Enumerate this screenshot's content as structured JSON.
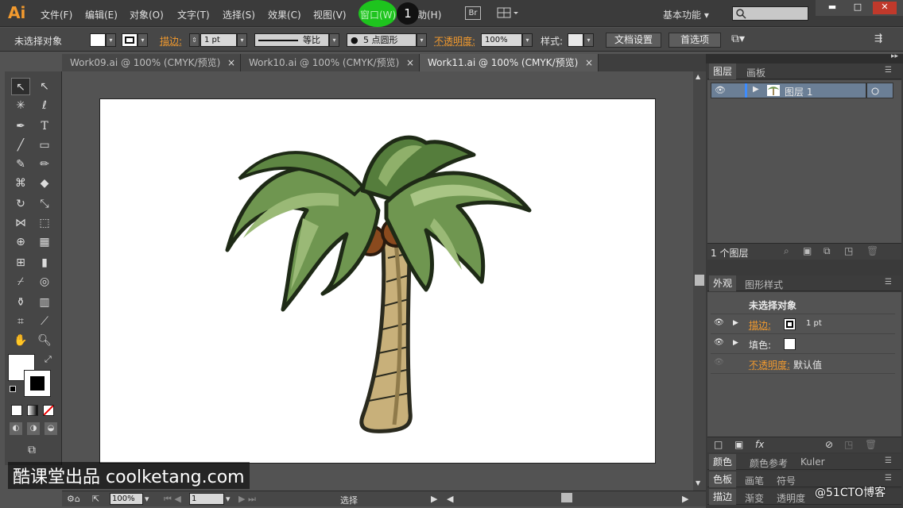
{
  "app": {
    "logo": "Ai"
  },
  "menus": [
    "文件(F)",
    "编辑(E)",
    "对象(O)",
    "文字(T)",
    "选择(S)",
    "效果(C)",
    "视图(V)",
    "窗口(W)",
    "帮助(H)"
  ],
  "toolbar_right": {
    "bridge": "Br",
    "workspace": "基本功能 ▾"
  },
  "window_controls": {
    "minimize": "▬",
    "restore": "□",
    "close": "✕"
  },
  "step_badge": "1",
  "control_bar": {
    "selection_status": "未选择对象",
    "stroke_label": "描边:",
    "stroke_value": "1 pt",
    "stroke_profile": "等比",
    "brush": "5 点圆形",
    "opacity_label": "不透明度:",
    "opacity_value": "100%",
    "style_label": "样式:",
    "doc_setup_button": "文档设置",
    "preferences_button": "首选项"
  },
  "doc_tabs": [
    {
      "label": "Work09.ai @ 100% (CMYK/预览)",
      "active": false
    },
    {
      "label": "Work10.ai @ 100% (CMYK/预览)",
      "active": false
    },
    {
      "label": "Work11.ai @ 100% (CMYK/预览)",
      "active": true
    }
  ],
  "status_bar": {
    "zoom": "100%",
    "page": "1",
    "status": "选择"
  },
  "watermarks": {
    "left": "酷课堂出品 coolketang.com",
    "right": "@51CTO博客"
  },
  "layers_panel": {
    "tabs": [
      "图层",
      "画板"
    ],
    "layer_name": "图层 1",
    "footer_count": "1 个图层"
  },
  "appearance_panel": {
    "tabs": [
      "外观",
      "图形样式"
    ],
    "title": "未选择对象",
    "stroke_label": "描边:",
    "stroke_value": "1 pt",
    "fill_label": "填色:",
    "opacity_label": "不透明度:",
    "opacity_value": "默认值"
  },
  "color_panels": {
    "row1": [
      "颜色",
      "颜色参考",
      "Kuler"
    ],
    "row2": [
      "色板",
      "画笔",
      "符号"
    ],
    "row3": [
      "描边",
      "渐变",
      "透明度"
    ]
  },
  "colors": {
    "accent": "#f29a2e",
    "click_marker": "#1ec41e",
    "palm_light": "#8fb06a",
    "palm_dark": "#4f7a3a",
    "trunk": "#c8b07a",
    "coconut": "#8a4a1e"
  }
}
